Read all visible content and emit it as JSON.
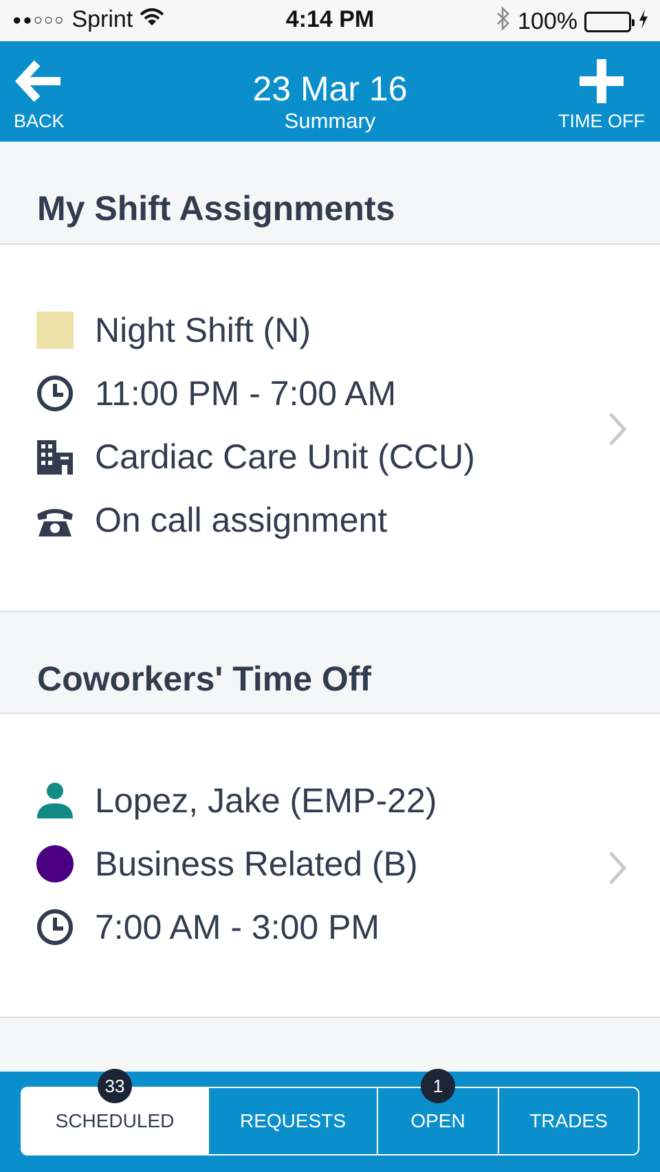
{
  "status_bar": {
    "signal": "●●○○○",
    "carrier": "Sprint",
    "time": "4:14 PM",
    "battery": "100%"
  },
  "nav": {
    "back_label": "BACK",
    "title": "23 Mar 16",
    "subtitle": "Summary",
    "time_off_label": "TIME OFF"
  },
  "shift_section": {
    "heading": "My Shift Assignments",
    "shift_name": "Night Shift (N)",
    "shift_color": "#ede3a8",
    "time": "11:00 PM - 7:00 AM",
    "unit": "Cardiac Care Unit (CCU)",
    "assignment": "On call assignment"
  },
  "timeoff_section": {
    "heading": "Coworkers' Time Off",
    "employee": "Lopez, Jake (EMP-22)",
    "person_color": "#128a88",
    "reason": "Business Related (B)",
    "reason_color": "#4b0082",
    "time": "7:00 AM - 3:00 PM"
  },
  "tabs": [
    {
      "label": "SCHEDULED",
      "badge": "33"
    },
    {
      "label": "REQUESTS"
    },
    {
      "label": "OPEN",
      "badge": "1"
    },
    {
      "label": "TRADES"
    }
  ],
  "colors": {
    "brand": "#0a8fcc",
    "text": "#333b4f",
    "badge": "#1b2535"
  }
}
